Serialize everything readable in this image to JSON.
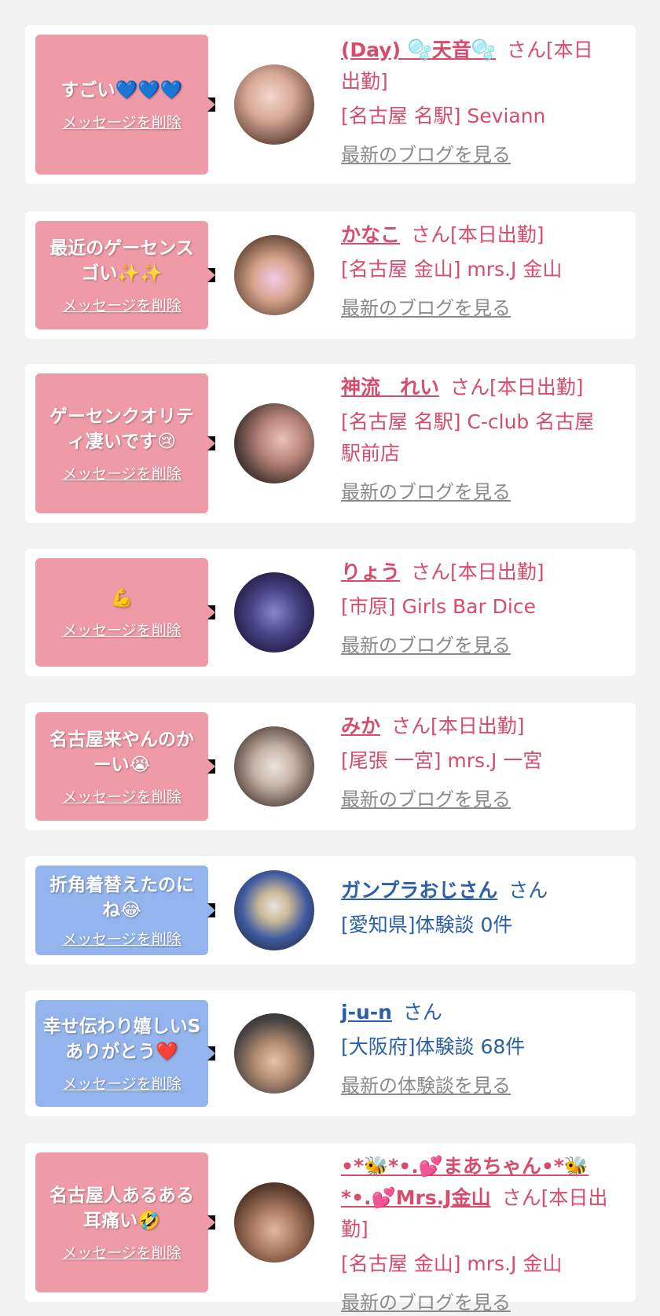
{
  "delete_label": "メッセージを削除",
  "cards": [
    {
      "message": "すごい💙💙💙",
      "name": "(Day) 🫧天音🫧",
      "suffix": "さん[本日出勤]",
      "shop": "[名古屋 名駅] Seviann",
      "link": "最新のブログを見る"
    },
    {
      "message": "最近のゲーセンスゴい✨✨",
      "name": "かなこ",
      "suffix": "さん[本日出勤]",
      "shop": "[名古屋 金山] mrs.J 金山",
      "link": "最新のブログを見る"
    },
    {
      "message": "ゲーセンクオリティ凄いです😢",
      "name": "神流　れい",
      "suffix": "さん[本日出勤]",
      "shop": "[名古屋 名駅] C-club 名古屋駅前店",
      "link": "最新のブログを見る"
    },
    {
      "message": "💪",
      "name": "りょう",
      "suffix": "さん[本日出勤]",
      "shop": "[市原] Girls Bar Dice",
      "link": "最新のブログを見る"
    },
    {
      "message": "名古屋来やんのかーい😭",
      "name": "みか",
      "suffix": "さん[本日出勤]",
      "shop": "[尾張 一宮] mrs.J 一宮",
      "link": "最新のブログを見る"
    },
    {
      "message": "折角着替えたのにね😂",
      "name": "ガンプラおじさん",
      "suffix": "さん",
      "shop": "[愛知県]体験談 0件",
      "link": ""
    },
    {
      "message": "幸せ伝わり嬉しいSありがとう❤️",
      "name": "j-u-n",
      "suffix": "さん",
      "shop": "[大阪府]体験談 68件",
      "link": "最新の体験談を見る"
    },
    {
      "message": "名古屋人あるある耳痛い🤣",
      "name": "•*🐝*•.💕まあちゃん•*🐝*•.💕Mrs.J金山",
      "suffix": "さん[本日出勤]",
      "shop": "[名古屋 金山] mrs.J 金山",
      "link": "最新のブログを見る"
    }
  ],
  "colors": {
    "pink_bubble": "#ef9aa7",
    "blue_bubble": "#93b4ec",
    "pink_text": "#d74c6c",
    "blue_text": "#2b5fa8"
  }
}
